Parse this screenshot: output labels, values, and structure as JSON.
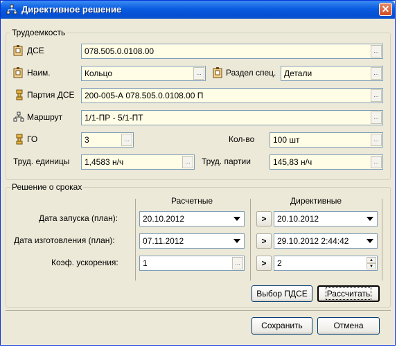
{
  "window": {
    "title": "Директивное решение"
  },
  "labor": {
    "group_title": "Трудоемкость",
    "dse_label": "ДСЕ",
    "dse_value": "078.505.0.0108.00",
    "name_label": "Наим.",
    "name_value": "Кольцо",
    "section_label": "Раздел спец.",
    "section_value": "Детали",
    "batch_label": "Партия ДСЕ",
    "batch_value": "200-005-А 078.505.0.0108.00 П",
    "route_label": "Маршрут",
    "route_value": "1/1-ПР - 5/1-ПТ",
    "go_label": "ГО",
    "go_value": "3",
    "qty_label": "Кол-во",
    "qty_value": "100 шт",
    "unit_labor_label": "Труд. единицы",
    "unit_labor_value": "1,4583 н/ч",
    "batch_labor_label": "Труд. партии",
    "batch_labor_value": "145,83 н/ч"
  },
  "terms": {
    "group_title": "Решение о сроках",
    "col_calc": "Расчетные",
    "col_directive": "Директивные",
    "launch_label": "Дата запуска (план):",
    "launch_calc": "20.10.2012",
    "launch_directive": "20.10.2012",
    "make_label": "Дата изготовления (план):",
    "make_calc": "07.11.2012",
    "make_directive": "29.10.2012 2:44:42",
    "accel_label": "Коэф. ускорения:",
    "accel_calc": "1",
    "accel_directive": "2",
    "arrow": ">",
    "select_pdse": "Выбор ПДСЕ",
    "calculate": "Рассчитать"
  },
  "footer": {
    "save": "Сохранить",
    "cancel": "Отмена"
  },
  "icons": {
    "ellipsis": "...",
    "close": "✕"
  }
}
